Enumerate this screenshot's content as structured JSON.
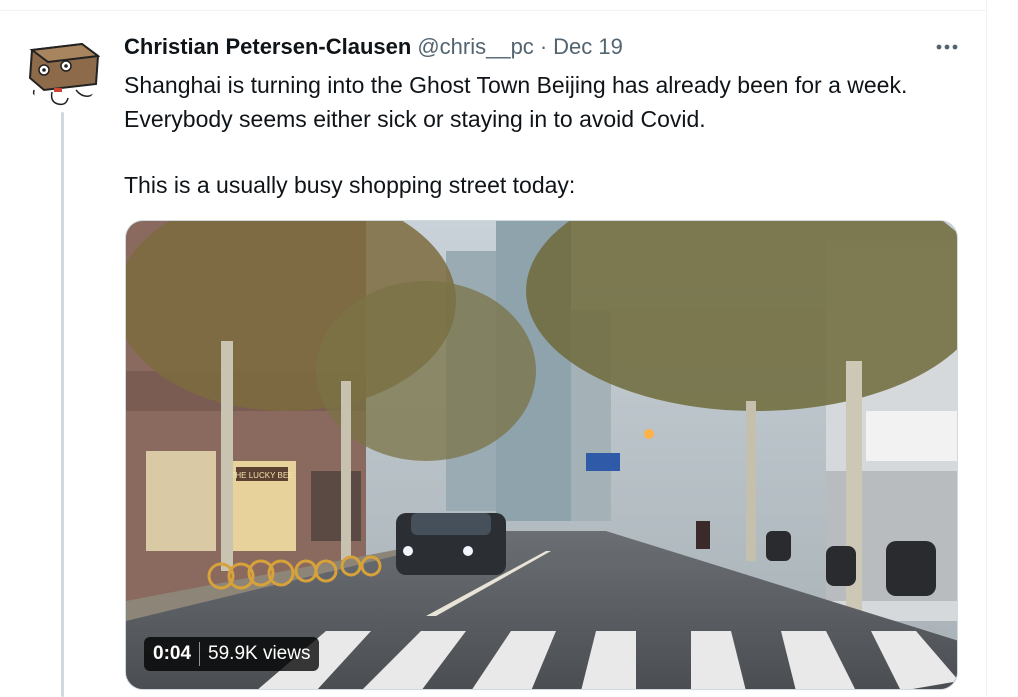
{
  "tweet": {
    "author_name": "Christian Petersen-Clausen",
    "author_handle": "@chris__pc",
    "separator": "·",
    "date": "Dec 19",
    "text_line1": "Shanghai is turning into the Ghost Town Beijing has already been for a week. Everybody seems either sick or staying in to avoid Covid.",
    "text_line2": "This is a usually busy shopping street today:"
  },
  "video": {
    "elapsed": "0:04",
    "views": "59.9K views",
    "sign_text": "THE LUCKY BEE"
  },
  "icons": {
    "more": "more-horizontal-icon",
    "avatar": "cartoon-box-avatar"
  },
  "colors": {
    "text_primary": "#0f1419",
    "text_secondary": "#536471",
    "thread_line": "#cfd9de"
  }
}
